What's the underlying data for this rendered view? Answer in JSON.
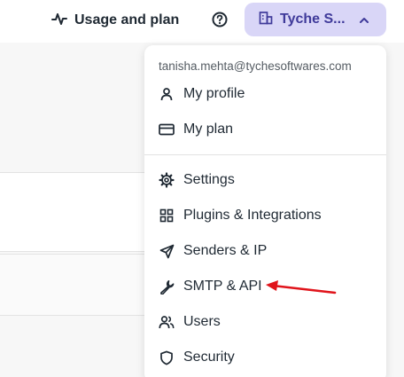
{
  "topbar": {
    "usage_label": "Usage and plan",
    "org_name": "Tyche S..."
  },
  "account_menu": {
    "email": "tanisha.mehta@tychesoftwares.com",
    "items": [
      {
        "label": "My profile",
        "icon": "user-icon"
      },
      {
        "label": "My plan",
        "icon": "credit-card-icon"
      },
      {
        "label": "Settings",
        "icon": "gear-icon"
      },
      {
        "label": "Plugins & Integrations",
        "icon": "grid-icon"
      },
      {
        "label": "Senders & IP",
        "icon": "send-icon"
      },
      {
        "label": "SMTP & API",
        "icon": "wrench-icon"
      },
      {
        "label": "Users",
        "icon": "users-icon"
      },
      {
        "label": "Security",
        "icon": "shield-icon"
      }
    ]
  },
  "colors": {
    "org_button_bg": "#d9d6f7",
    "org_button_text": "#3f3a9a",
    "annotation_arrow": "#e0141b"
  }
}
